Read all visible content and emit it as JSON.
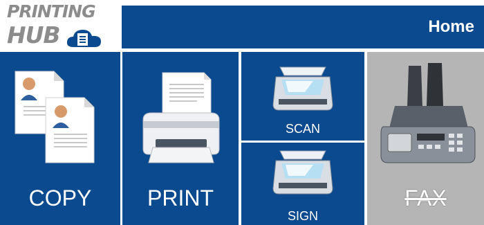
{
  "brand": {
    "logo_line1": "PRINTING",
    "logo_line2": "HUB"
  },
  "header": {
    "title": "Home"
  },
  "tiles": [
    {
      "id": "copy",
      "label": "COPY",
      "icon": "copy-documents-icon",
      "enabled": true
    },
    {
      "id": "print",
      "label": "PRINT",
      "icon": "printer-icon",
      "enabled": true
    },
    {
      "id": "scan",
      "label": "SCAN",
      "icon": "scanner-icon",
      "enabled": true
    },
    {
      "id": "sign",
      "label": "SIGN",
      "icon": "scanner-icon",
      "enabled": true
    },
    {
      "id": "fax",
      "label": "FAX",
      "icon": "fax-machine-icon",
      "enabled": false
    }
  ],
  "colors": {
    "tile_blue": "#0c4a8f",
    "disabled_gray": "#b5b5b5",
    "logo_gray": "#8c8c8c"
  }
}
